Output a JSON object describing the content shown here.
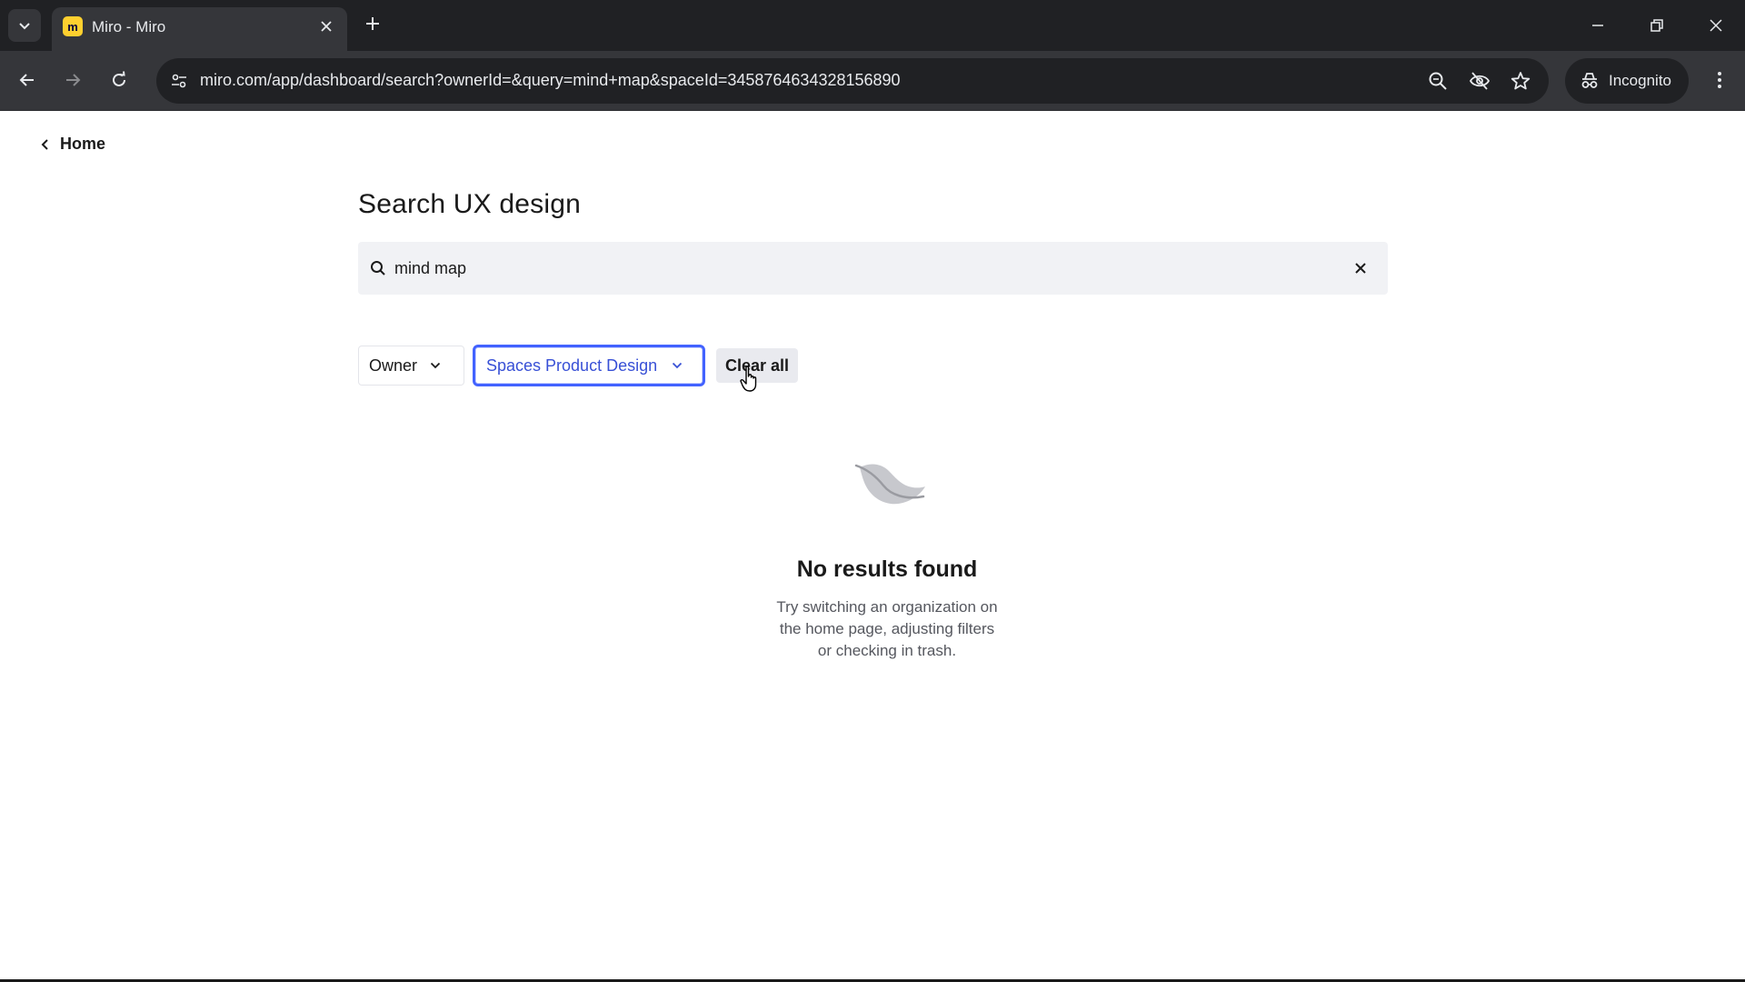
{
  "browser": {
    "tab_title": "Miro - Miro",
    "favicon_letter": "m",
    "url": "miro.com/app/dashboard/search?ownerId=&query=mind+map&spaceId=3458764634328156890",
    "incognito_label": "Incognito"
  },
  "page": {
    "back_label": "Home",
    "title": "Search UX design"
  },
  "search": {
    "value": "mind map"
  },
  "filters": {
    "owner_label": "Owner",
    "space_label": "Spaces Product Design",
    "clear_all_label": "Clear all"
  },
  "empty_state": {
    "title": "No results found",
    "description_line1": "Try switching an organization on",
    "description_line2": "the home page, adjusting filters",
    "description_line3": "or checking in trash."
  },
  "colors": {
    "accent": "#4262ff",
    "chrome_dark": "#202124",
    "chrome_toolbar": "#35363a",
    "miro_yellow": "#ffd02f"
  }
}
